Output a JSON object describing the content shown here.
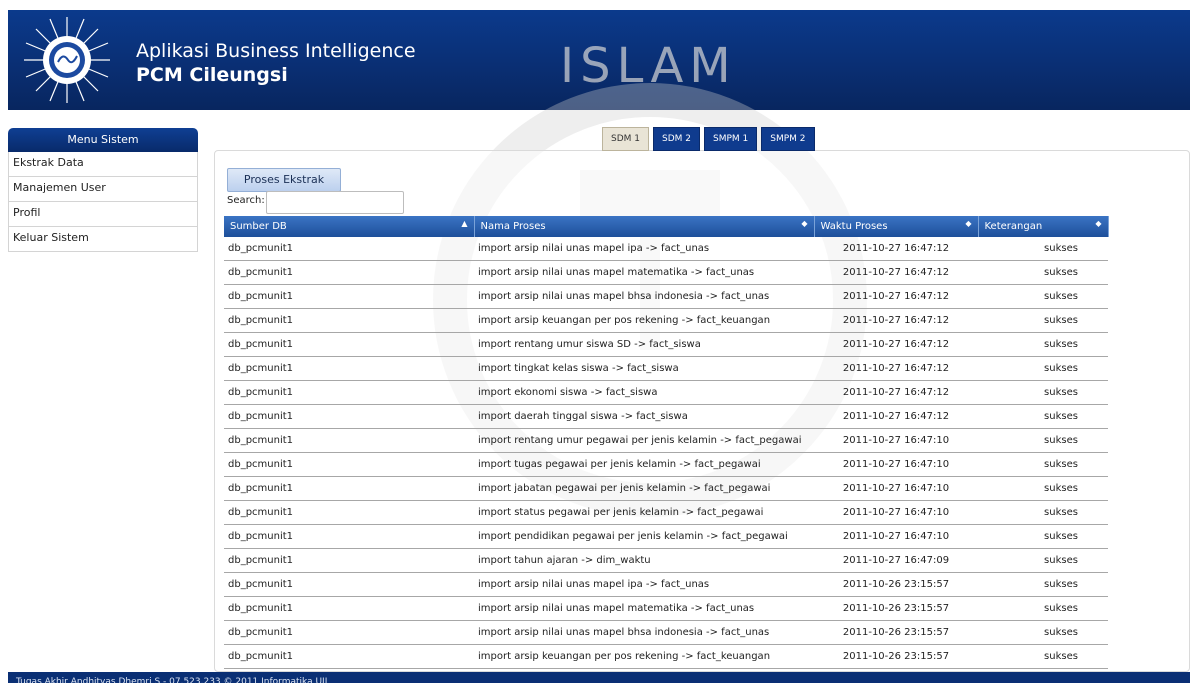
{
  "header": {
    "title": "Aplikasi Business Intelligence",
    "subtitle": "PCM Cileungsi",
    "logo_icon": "muhammadiyah-sun-logo"
  },
  "watermark": {
    "text": "ISLAM"
  },
  "sidebar": {
    "header": "Menu Sistem",
    "items": [
      {
        "label": "Ekstrak Data"
      },
      {
        "label": "Manajemen User"
      },
      {
        "label": "Profil"
      },
      {
        "label": "Keluar Sistem"
      }
    ]
  },
  "tabs": [
    {
      "label": "SDM 1",
      "active": true
    },
    {
      "label": "SDM 2",
      "active": false
    },
    {
      "label": "SMPM 1",
      "active": false
    },
    {
      "label": "SMPM 2",
      "active": false
    }
  ],
  "toolbar": {
    "proses_label": "Proses Ekstrak",
    "search_label": "Search:",
    "search_value": ""
  },
  "table": {
    "columns": [
      "Sumber DB",
      "Nama Proses",
      "Waktu Proses",
      "Keterangan"
    ],
    "sort_icons": [
      "▲",
      "◆",
      "◆",
      "◆"
    ],
    "rows": [
      [
        "db_pcmunit1",
        "import arsip nilai unas mapel ipa -> fact_unas",
        "2011-10-27 16:47:12",
        "sukses"
      ],
      [
        "db_pcmunit1",
        "import arsip nilai unas mapel matematika -> fact_unas",
        "2011-10-27 16:47:12",
        "sukses"
      ],
      [
        "db_pcmunit1",
        "import arsip nilai unas mapel bhsa indonesia -> fact_unas",
        "2011-10-27 16:47:12",
        "sukses"
      ],
      [
        "db_pcmunit1",
        "import arsip keuangan per pos rekening -> fact_keuangan",
        "2011-10-27 16:47:12",
        "sukses"
      ],
      [
        "db_pcmunit1",
        "import rentang umur siswa SD -> fact_siswa",
        "2011-10-27 16:47:12",
        "sukses"
      ],
      [
        "db_pcmunit1",
        "import tingkat kelas siswa -> fact_siswa",
        "2011-10-27 16:47:12",
        "sukses"
      ],
      [
        "db_pcmunit1",
        "import ekonomi siswa -> fact_siswa",
        "2011-10-27 16:47:12",
        "sukses"
      ],
      [
        "db_pcmunit1",
        "import daerah tinggal siswa -> fact_siswa",
        "2011-10-27 16:47:12",
        "sukses"
      ],
      [
        "db_pcmunit1",
        "import rentang umur pegawai per jenis kelamin -> fact_pegawai",
        "2011-10-27 16:47:10",
        "sukses"
      ],
      [
        "db_pcmunit1",
        "import tugas pegawai per jenis kelamin -> fact_pegawai",
        "2011-10-27 16:47:10",
        "sukses"
      ],
      [
        "db_pcmunit1",
        "import jabatan pegawai per jenis kelamin -> fact_pegawai",
        "2011-10-27 16:47:10",
        "sukses"
      ],
      [
        "db_pcmunit1",
        "import status pegawai per jenis kelamin -> fact_pegawai",
        "2011-10-27 16:47:10",
        "sukses"
      ],
      [
        "db_pcmunit1",
        "import pendidikan pegawai per jenis kelamin -> fact_pegawai",
        "2011-10-27 16:47:10",
        "sukses"
      ],
      [
        "db_pcmunit1",
        "import tahun ajaran -> dim_waktu",
        "2011-10-27 16:47:09",
        "sukses"
      ],
      [
        "db_pcmunit1",
        "import arsip nilai unas mapel ipa -> fact_unas",
        "2011-10-26 23:15:57",
        "sukses"
      ],
      [
        "db_pcmunit1",
        "import arsip nilai unas mapel matematika -> fact_unas",
        "2011-10-26 23:15:57",
        "sukses"
      ],
      [
        "db_pcmunit1",
        "import arsip nilai unas mapel bhsa indonesia -> fact_unas",
        "2011-10-26 23:15:57",
        "sukses"
      ],
      [
        "db_pcmunit1",
        "import arsip keuangan per pos rekening -> fact_keuangan",
        "2011-10-26 23:15:57",
        "sukses"
      ]
    ]
  },
  "footer": {
    "text": "Tugas Akhir Andhityas Dhemri S - 07.523.233 © 2011 Informatika UII"
  },
  "colors": {
    "header_bg": "#0a2f74",
    "table_header": "#2b5fae",
    "tab_bg": "#0f3b8e"
  }
}
